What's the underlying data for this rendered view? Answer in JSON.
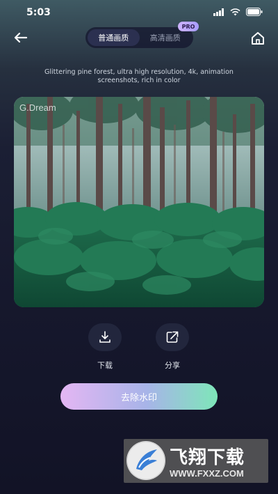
{
  "status_bar": {
    "time": "5:03"
  },
  "quality_tabs": [
    {
      "label": "普通画质",
      "active": true
    },
    {
      "label": "高清画质",
      "active": false
    }
  ],
  "pro_badge": "PRO",
  "prompt": "Glittering pine forest, ultra high resolution, 4k, animation screenshots, rich in color",
  "image": {
    "watermark": "G.Dream"
  },
  "actions": {
    "download_label": "下载",
    "share_label": "分享"
  },
  "remove_watermark_label": "去除水印",
  "ad": {
    "title": "飞翔下载",
    "url": "WWW.FXXZ.COM"
  },
  "colors": {
    "bg_dark": "#16182d",
    "accent_gradient": [
      "#e4b6f3",
      "#a7b4e8",
      "#7ee6b9"
    ],
    "pro_badge": "#b8a8ff"
  }
}
